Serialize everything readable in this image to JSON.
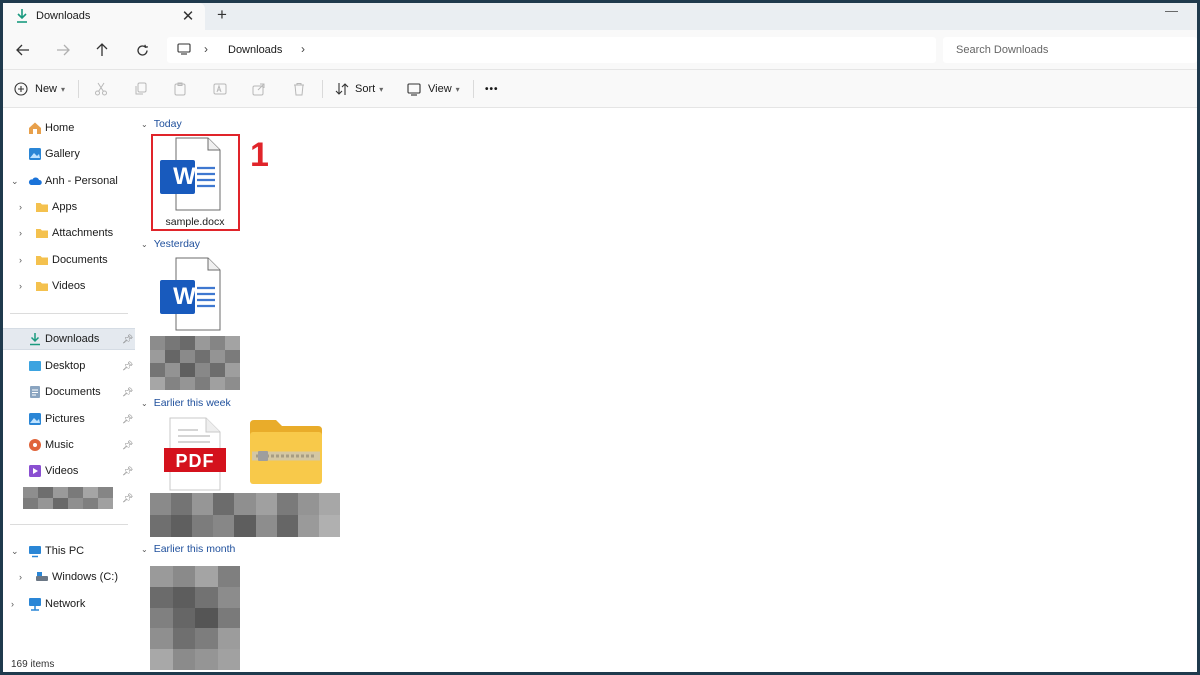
{
  "tab": {
    "title": "Downloads",
    "close": "✕",
    "new": "+"
  },
  "address": {
    "crumb": "Downloads",
    "separator": "›"
  },
  "search": {
    "placeholder": "Search Downloads"
  },
  "toolbar": {
    "new_label": "New",
    "sort_label": "Sort",
    "view_label": "View",
    "more": "•••"
  },
  "sidebar": {
    "home": "Home",
    "gallery": "Gallery",
    "onedrive": "Anh - Personal",
    "od_children": [
      "Apps",
      "Attachments",
      "Documents",
      "Videos"
    ],
    "quick": [
      "Downloads",
      "Desktop",
      "Documents",
      "Pictures",
      "Music",
      "Videos"
    ],
    "this_pc": "This PC",
    "drive_c": "Windows (C:)",
    "network": "Network"
  },
  "groups": {
    "today": "Today",
    "yesterday": "Yesterday",
    "earlier_week": "Earlier this week",
    "earlier_month": "Earlier this month"
  },
  "files": {
    "sample": "sample.docx",
    "word_letter": "W",
    "pdf_label": "PDF"
  },
  "annotation": "1",
  "status": "169 items",
  "colors": {
    "accent": "#1e4f9c",
    "highlight": "#e0242a",
    "word_blue": "#185abd",
    "pdf_red": "#d4111c",
    "folder_yellow": "#f8c94a"
  }
}
